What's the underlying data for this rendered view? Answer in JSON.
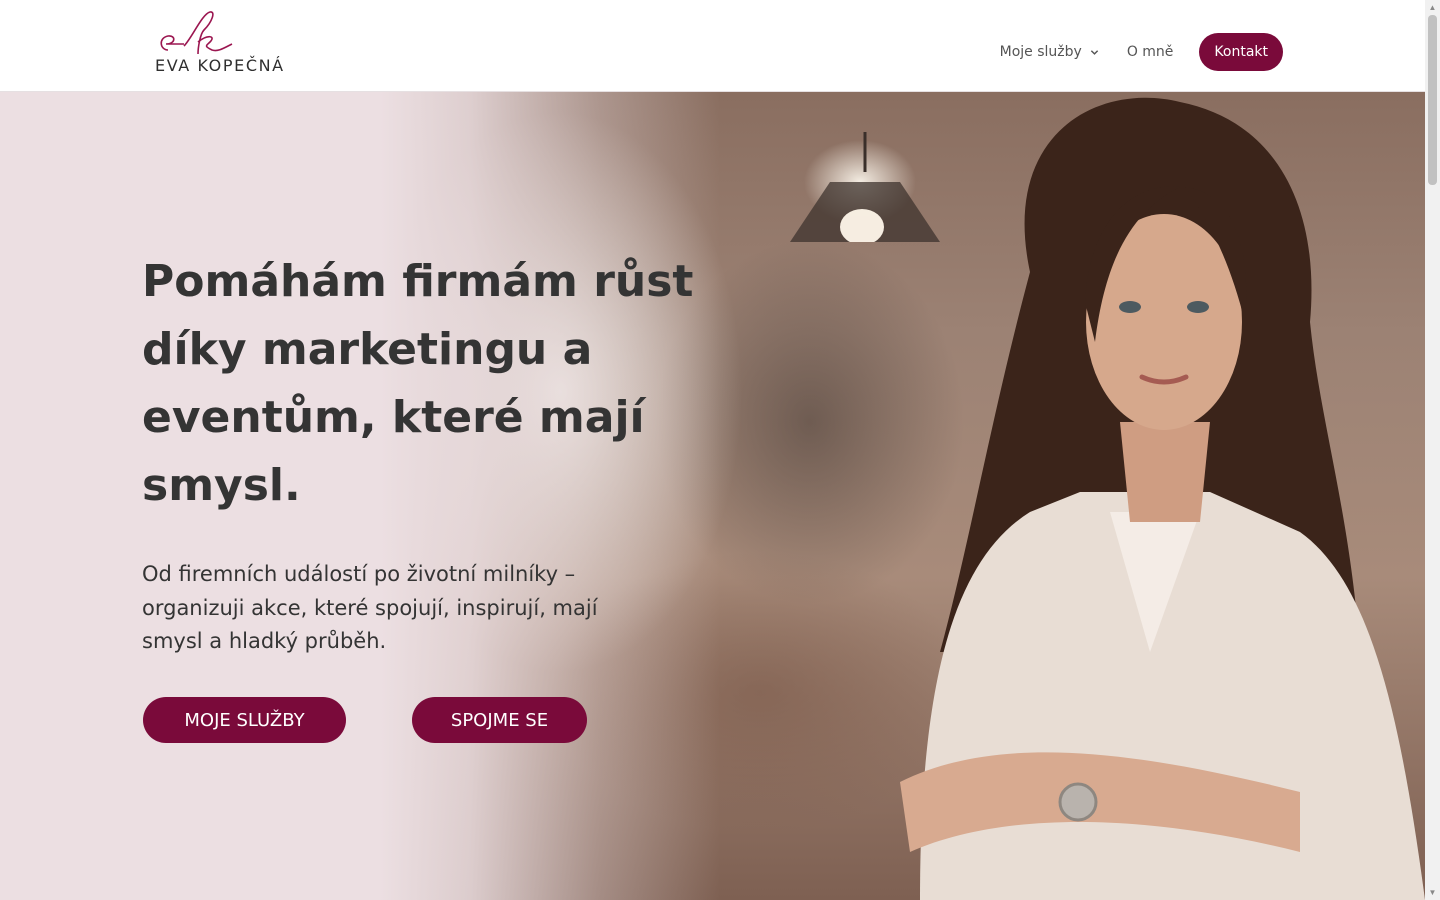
{
  "header": {
    "logo": {
      "monogram": "ek",
      "name": "EVA KOPEČNÁ"
    },
    "nav": {
      "services_label": "Moje služby",
      "about_label": "O mně",
      "contact_label": "Kontakt"
    }
  },
  "hero": {
    "headline": "Pomáhám firmám růst díky marketingu a eventům, které mají smysl.",
    "subheadline": "Od firemních událostí po životní milníky – organizuji akce, které spojují, inspirují, mají smysl a hladký průběh.",
    "buttons": {
      "services_label": "MOJE SLUŽBY",
      "contact_label": "SPOJME SE"
    }
  },
  "colors": {
    "brand": "#7a0a3a",
    "hero_background": "#ecdfe2",
    "text": "#343434"
  },
  "icons": {
    "nav_dropdown": "chevron-down-icon",
    "scroll_up": "arrow-up-icon",
    "scroll_down": "arrow-down-icon"
  }
}
